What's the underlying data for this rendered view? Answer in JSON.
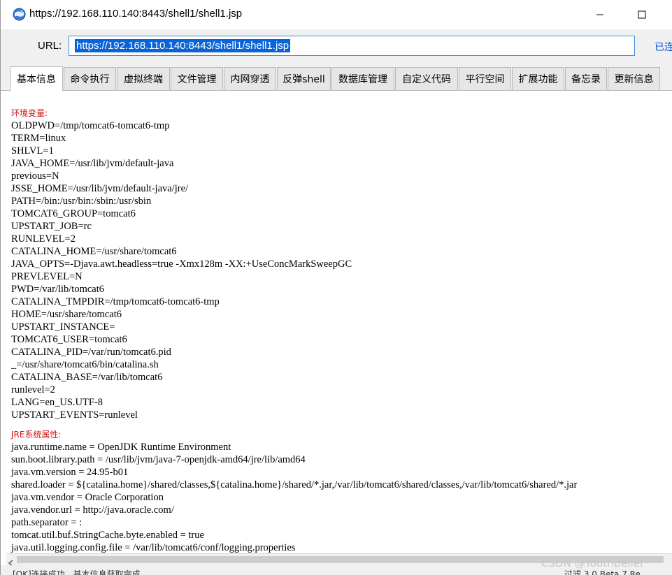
{
  "window": {
    "title": "https://192.168.110.140:8443/shell1/shell1.jsp",
    "icon": "app-globe-icon"
  },
  "urlbar": {
    "label": "URL:",
    "value": "https://192.168.110.140:8443/shell1/shell1.jsp",
    "status": "已连"
  },
  "tabs": [
    {
      "label": "基本信息"
    },
    {
      "label": "命令执行"
    },
    {
      "label": "虚拟终端"
    },
    {
      "label": "文件管理"
    },
    {
      "label": "内网穿透"
    },
    {
      "label": "反弹shell"
    },
    {
      "label": "数据库管理"
    },
    {
      "label": "自定义代码"
    },
    {
      "label": "平行空间"
    },
    {
      "label": "扩展功能"
    },
    {
      "label": "备忘录"
    },
    {
      "label": "更新信息"
    }
  ],
  "content": {
    "env_heading": "环境变量:",
    "env_lines": [
      "OLDPWD=/tmp/tomcat6-tomcat6-tmp",
      "TERM=linux",
      "SHLVL=1",
      "JAVA_HOME=/usr/lib/jvm/default-java",
      "previous=N",
      "JSSE_HOME=/usr/lib/jvm/default-java/jre/",
      "PATH=/bin:/usr/bin:/sbin:/usr/sbin",
      "TOMCAT6_GROUP=tomcat6",
      "UPSTART_JOB=rc",
      "RUNLEVEL=2",
      "CATALINA_HOME=/usr/share/tomcat6",
      "JAVA_OPTS=-Djava.awt.headless=true -Xmx128m -XX:+UseConcMarkSweepGC",
      "PREVLEVEL=N",
      "PWD=/var/lib/tomcat6",
      "CATALINA_TMPDIR=/tmp/tomcat6-tomcat6-tmp",
      "HOME=/usr/share/tomcat6",
      "UPSTART_INSTANCE=",
      "TOMCAT6_USER=tomcat6",
      "CATALINA_PID=/var/run/tomcat6.pid",
      "_=/usr/share/tomcat6/bin/catalina.sh",
      "CATALINA_BASE=/var/lib/tomcat6",
      "runlevel=2",
      "LANG=en_US.UTF-8",
      "UPSTART_EVENTS=runlevel"
    ],
    "jre_heading": "JRE系统属性:",
    "jre_lines": [
      "java.runtime.name = OpenJDK Runtime Environment",
      "sun.boot.library.path = /usr/lib/jvm/java-7-openjdk-amd64/jre/lib/amd64",
      "java.vm.version = 24.95-b01",
      "shared.loader = ${catalina.home}/shared/classes,${catalina.home}/shared/*.jar,/var/lib/tomcat6/shared/classes,/var/lib/tomcat6/shared/*.jar",
      "java.vm.vendor = Oracle Corporation",
      "java.vendor.url = http://java.oracle.com/",
      "path.separator = :",
      "tomcat.util.buf.StringCache.byte.enabled = true",
      "java.util.logging.config.file = /var/lib/tomcat6/conf/logging.properties"
    ]
  },
  "statusbar": {
    "left": "[OK]连接成功，基本信息获取完成",
    "right": "过滤    3.0 Beta 7    Re..."
  },
  "watermark": "CSDN @YouthBelief",
  "colors": {
    "accent": "#0a64d8",
    "heading": "#d01010",
    "chrome": "#f0f0f0"
  }
}
